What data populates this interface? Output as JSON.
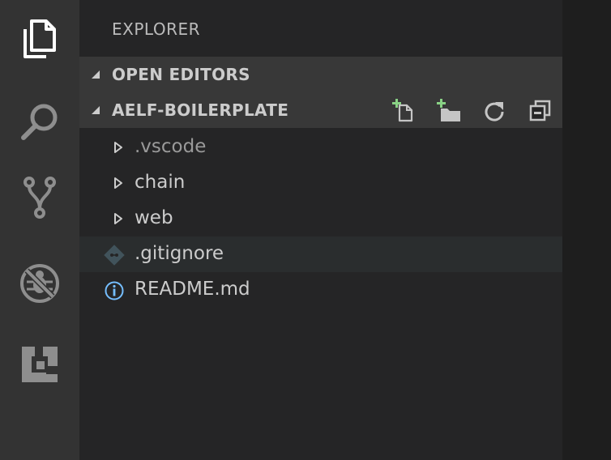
{
  "activity_bar": {
    "items": [
      {
        "name": "explorer",
        "icon": "files-icon"
      },
      {
        "name": "search",
        "icon": "search-icon"
      },
      {
        "name": "source-control",
        "icon": "source-control-icon"
      },
      {
        "name": "debug",
        "icon": "debug-icon"
      },
      {
        "name": "extensions",
        "icon": "extensions-icon"
      }
    ]
  },
  "sidebar": {
    "title": "EXPLORER",
    "open_editors": {
      "label": "OPEN EDITORS"
    },
    "project": {
      "label": "AELF-BOILERPLATE",
      "actions": [
        "new-file-icon",
        "new-folder-icon",
        "refresh-icon",
        "collapse-all-icon"
      ]
    },
    "tree": [
      {
        "label": ".vscode",
        "type": "folder"
      },
      {
        "label": "chain",
        "type": "folder"
      },
      {
        "label": "web",
        "type": "folder"
      },
      {
        "label": ".gitignore",
        "type": "git-file"
      },
      {
        "label": "README.md",
        "type": "info-file"
      }
    ]
  },
  "colors": {
    "activity_bar": "#333333",
    "sidebar": "#252526",
    "section_header": "#383838",
    "selected_row": "#2a2d2e",
    "add_green": "#89d185",
    "info_blue": "#75beff"
  }
}
